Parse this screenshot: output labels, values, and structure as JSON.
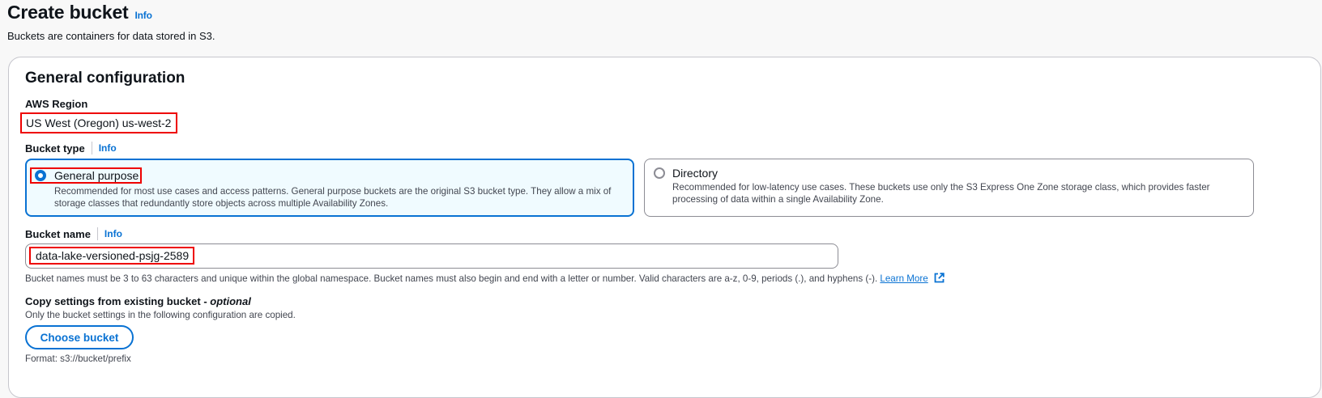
{
  "header": {
    "title": "Create bucket",
    "info": "Info",
    "description": "Buckets are containers for data stored in S3."
  },
  "general_config": {
    "title": "General configuration",
    "region": {
      "label": "AWS Region",
      "value": "US West (Oregon) us-west-2"
    },
    "bucket_type": {
      "label": "Bucket type",
      "info": "Info",
      "options": [
        {
          "name": "General purpose",
          "description": "Recommended for most use cases and access patterns. General purpose buckets are the original S3 bucket type. They allow a mix of storage classes that redundantly store objects across multiple Availability Zones.",
          "selected": true
        },
        {
          "name": "Directory",
          "description": "Recommended for low-latency use cases. These buckets use only the S3 Express One Zone storage class, which provides faster processing of data within a single Availability Zone.",
          "selected": false
        }
      ]
    },
    "bucket_name": {
      "label": "Bucket name",
      "info": "Info",
      "value": "data-lake-versioned-psjg-2589",
      "help": "Bucket names must be 3 to 63 characters and unique within the global namespace. Bucket names must also begin and end with a letter or number. Valid characters are a-z, 0-9, periods (.), and hyphens (-).",
      "learn_more": "Learn More"
    },
    "copy_settings": {
      "title": "Copy settings from existing bucket - ",
      "optional": "optional",
      "description": "Only the bucket settings in the following configuration are copied.",
      "button": "Choose bucket",
      "format": "Format: s3://bucket/prefix"
    }
  },
  "colors": {
    "accent": "#0972d3",
    "highlight_box": "#ee0000",
    "panel_border": "#c6c6cd"
  },
  "icons": {
    "external_link": "external-link-icon"
  }
}
